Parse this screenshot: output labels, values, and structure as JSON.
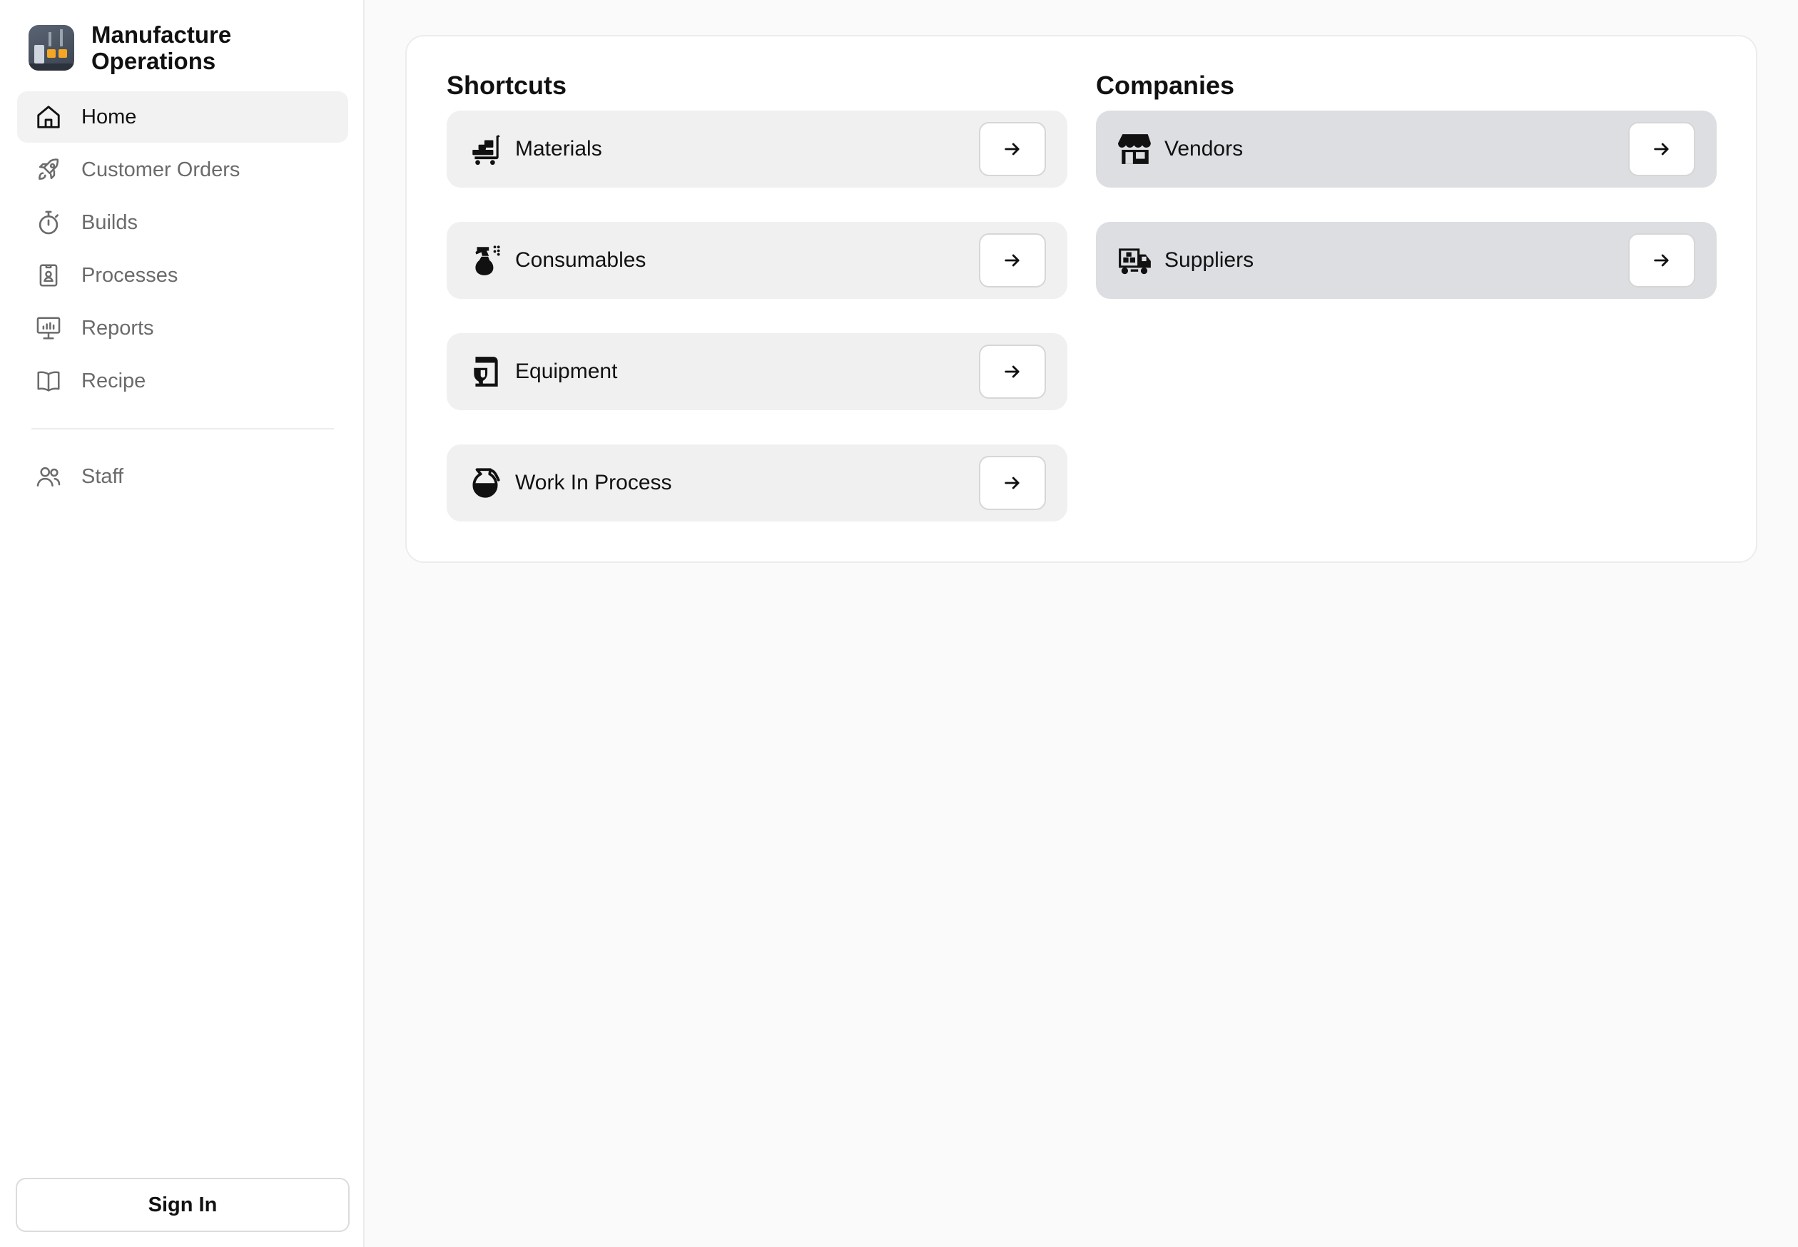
{
  "brand": {
    "title_line1": "Manufacture",
    "title_line2": "Operations",
    "logo_icon": "factory-logo-icon"
  },
  "sidebar": {
    "items": [
      {
        "label": "Home",
        "icon": "home-icon",
        "active": true
      },
      {
        "label": "Customer Orders",
        "icon": "rocket-icon",
        "active": false
      },
      {
        "label": "Builds",
        "icon": "stopwatch-icon",
        "active": false
      },
      {
        "label": "Processes",
        "icon": "id-badge-icon",
        "active": false
      },
      {
        "label": "Reports",
        "icon": "presentation-chart-icon",
        "active": false
      },
      {
        "label": "Recipe",
        "icon": "open-book-icon",
        "active": false
      }
    ],
    "secondary": [
      {
        "label": "Staff",
        "icon": "users-icon",
        "active": false
      }
    ],
    "signin_label": "Sign In"
  },
  "shortcuts": {
    "title": "Shortcuts",
    "items": [
      {
        "label": "Materials",
        "icon": "dolly-cart-icon"
      },
      {
        "label": "Consumables",
        "icon": "spray-bottle-icon"
      },
      {
        "label": "Equipment",
        "icon": "stand-mixer-icon"
      },
      {
        "label": "Work In Process",
        "icon": "jug-icon"
      }
    ]
  },
  "companies": {
    "title": "Companies",
    "items": [
      {
        "label": "Vendors",
        "icon": "storefront-icon"
      },
      {
        "label": "Suppliers",
        "icon": "delivery-truck-icon"
      }
    ]
  },
  "colors": {
    "active_nav_bg": "#f2f2f2",
    "shortcut_card_bg": "#f0f0f0",
    "company_card_bg": "#dcdee1",
    "muted_text": "#6b6b6b"
  }
}
